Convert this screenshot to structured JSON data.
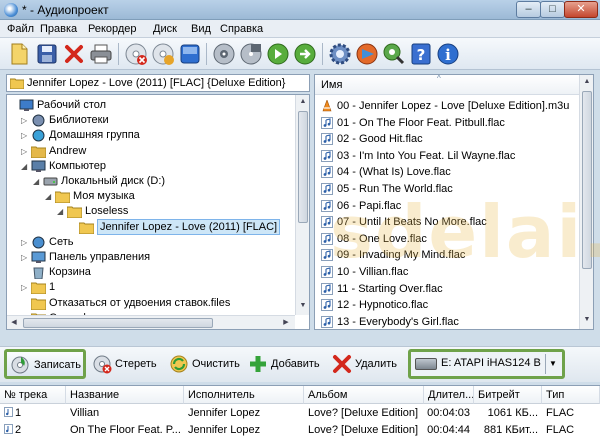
{
  "window": {
    "title": "* - Аудиопроект",
    "minimize": "–",
    "maximize": "□",
    "close": "✕"
  },
  "menu": [
    "Файл",
    "Правка",
    "Рекордер",
    "Диск",
    "Вид",
    "Справка"
  ],
  "toolbar": {
    "icons": [
      "new-project-icon",
      "save-icon",
      "delete-icon",
      "print-icon",
      "erase-disc-icon",
      "new-disc-icon",
      "disc-info-icon",
      "burn-image-icon",
      "copy-disc-icon",
      "play-icon",
      "forward-icon",
      "options-gear-icon",
      "media-player-icon",
      "search-disc-icon",
      "help-icon",
      "info-icon"
    ]
  },
  "tree": {
    "path": "Jennifer Lopez - Love (2011) [FLAC] {Deluxe Edition}",
    "items": [
      {
        "label": "Рабочий стол",
        "icon": "desktop-icon",
        "level": 0,
        "arrow": ""
      },
      {
        "label": "Библиотеки",
        "icon": "libraries-icon",
        "level": 1,
        "arrow": "▷"
      },
      {
        "label": "Домашняя группа",
        "icon": "homegroup-icon",
        "level": 1,
        "arrow": "▷"
      },
      {
        "label": "Andrew",
        "icon": "user-folder-icon",
        "level": 1,
        "arrow": "▷"
      },
      {
        "label": "Компьютер",
        "icon": "computer-icon",
        "level": 1,
        "arrow": "◢"
      },
      {
        "label": "Локальный диск (D:)",
        "icon": "drive-icon",
        "level": 2,
        "arrow": "◢"
      },
      {
        "label": "Моя музыка",
        "icon": "folder-icon",
        "level": 3,
        "arrow": "◢"
      },
      {
        "label": "Loseless",
        "icon": "folder-icon",
        "level": 4,
        "arrow": "◢"
      },
      {
        "label": "Jennifer Lopez - Love (2011) [FLAC]",
        "icon": "folder-open-icon",
        "level": 5,
        "arrow": "",
        "selected": true
      },
      {
        "label": "Сеть",
        "icon": "network-icon",
        "level": 1,
        "arrow": "▷"
      },
      {
        "label": "Панель управления",
        "icon": "control-panel-icon",
        "level": 1,
        "arrow": "▷"
      },
      {
        "label": "Корзина",
        "icon": "recycle-bin-icon",
        "level": 1,
        "arrow": ""
      },
      {
        "label": "1",
        "icon": "folder-icon",
        "level": 1,
        "arrow": "▷"
      },
      {
        "label": "Отказаться от удвоения ставок.files",
        "icon": "folder-icon",
        "level": 1,
        "arrow": ""
      },
      {
        "label": "Сертификаты",
        "icon": "folder-icon",
        "level": 1,
        "arrow": ""
      }
    ]
  },
  "files": {
    "column": "Имя",
    "items": [
      {
        "name": "00 - Jennifer Lopez - Love [Deluxe Edition].m3u",
        "type": "playlist"
      },
      {
        "name": "01 - On The Floor Feat. Pitbull.flac",
        "type": "audio"
      },
      {
        "name": "02 - Good Hit.flac",
        "type": "audio"
      },
      {
        "name": "03 - I'm Into You Feat. Lil Wayne.flac",
        "type": "audio"
      },
      {
        "name": "04 - (What Is) Love.flac",
        "type": "audio"
      },
      {
        "name": "05 - Run The World.flac",
        "type": "audio"
      },
      {
        "name": "06 - Papi.flac",
        "type": "audio"
      },
      {
        "name": "07 - Until It Beats No More.flac",
        "type": "audio"
      },
      {
        "name": "08 - One Love.flac",
        "type": "audio"
      },
      {
        "name": "09 - Invading My Mind.flac",
        "type": "audio"
      },
      {
        "name": "10 - Villian.flac",
        "type": "audio"
      },
      {
        "name": "11 - Starting Over.flac",
        "type": "audio"
      },
      {
        "name": "12 - Hypnotico.flac",
        "type": "audio"
      },
      {
        "name": "13 - Everybody's Girl.flac",
        "type": "audio"
      }
    ]
  },
  "actions": {
    "burn": "Записать",
    "erase": "Стереть",
    "clear": "Очистить",
    "add": "Добавить",
    "remove": "Удалить",
    "drive": "E: ATAPI iHAS124   B"
  },
  "tracks": {
    "columns": [
      "№ трека",
      "Название",
      "Исполнитель",
      "Альбом",
      "Длител...",
      "Битрейт",
      "Тип"
    ],
    "rows": [
      [
        "1",
        "Villian",
        "Jennifer Lopez",
        "Love? [Deluxe Edition]",
        "00:04:03",
        "1061 КБ...",
        "FLAC"
      ],
      [
        "2",
        "On The Floor Feat. P...",
        "Jennifer Lopez",
        "Love? [Deluxe Edition]",
        "00:04:44",
        "881 КБит...",
        "FLAC"
      ]
    ]
  },
  "watermark": "sdelai.ru"
}
